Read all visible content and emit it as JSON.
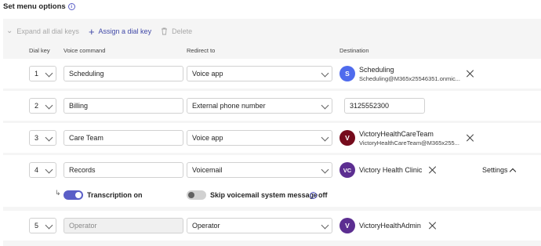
{
  "page": {
    "title": "Set menu options",
    "info_icon": "info-icon"
  },
  "toolbar": {
    "expand_label": "Expand all dial keys",
    "assign_label": "Assign a dial key",
    "delete_label": "Delete"
  },
  "columns": {
    "dial_key": "Dial key",
    "voice_command": "Voice command",
    "redirect_to": "Redirect to",
    "destination": "Destination"
  },
  "rows": [
    {
      "key": "1",
      "voice": "Scheduling",
      "redirect": "Voice app",
      "dest_initials": "S",
      "dest_color": "#4f6bed",
      "dest_name": "Scheduling",
      "dest_sub": "Scheduling@M365x25546351.onmic..."
    },
    {
      "key": "2",
      "voice": "Billing",
      "redirect": "External phone number",
      "phone": "3125552300"
    },
    {
      "key": "3",
      "voice": "Care Team",
      "redirect": "Voice app",
      "dest_initials": "V",
      "dest_color": "#750b1c",
      "dest_name": "VictoryHealthCareTeam",
      "dest_sub": "VictoryHealthCareTeam@M365x255..."
    },
    {
      "key": "4",
      "voice": "Records",
      "redirect": "Voicemail",
      "dest_initials": "VC",
      "dest_color": "#5c2e91",
      "dest_name": "Victory Health Clinic",
      "settings_label": "Settings"
    },
    {
      "key": "5",
      "voice": "Operator",
      "redirect": "Operator",
      "dest_initials": "V",
      "dest_color": "#5c2e91",
      "dest_name": "VictoryHealthAdmin"
    }
  ],
  "voicemail_options": {
    "transcription_label": "Transcription on",
    "transcription_on": true,
    "skip_label": "Skip voicemail system message",
    "skip_state": "off",
    "skip_on": false
  },
  "colors": {
    "accent": "#5b5fc7",
    "panel_bg": "#f5f5f5"
  }
}
